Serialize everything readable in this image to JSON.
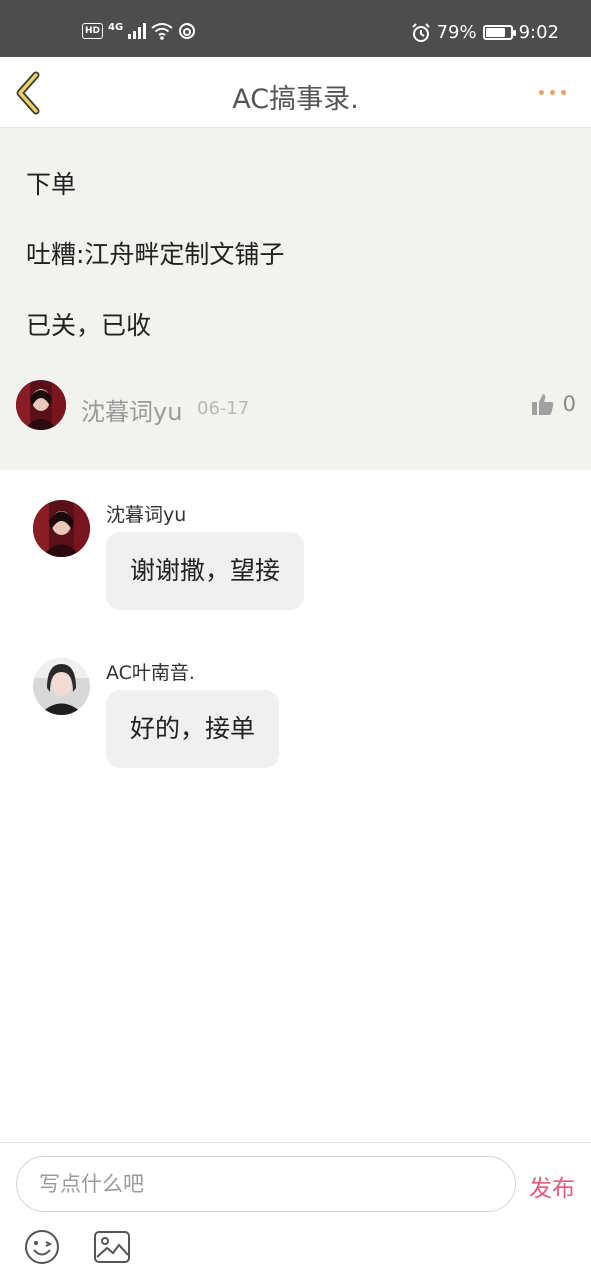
{
  "status_bar": {
    "hd": "HD",
    "network": "4G",
    "battery_percent": "79%",
    "battery_level": 0.79,
    "time": "9:02"
  },
  "header": {
    "title": "AC搞事录.",
    "back_icon": "chevron-left-icon",
    "more_icon": "more-dots-icon",
    "accent_color": "#f0a060"
  },
  "post": {
    "lines": [
      "下单",
      "吐糟:江舟畔定制文铺子",
      "已关，已收"
    ],
    "author": "沈暮词yu",
    "date": "06-17",
    "like_count": "0"
  },
  "comments": [
    {
      "author": "沈暮词yu",
      "text": "谢谢撒，望接"
    },
    {
      "author": "AC叶南音.",
      "text": "好的，接单"
    }
  ],
  "composer": {
    "placeholder": "写点什么吧",
    "publish_label": "发布",
    "publish_color": "#e85a7a",
    "emoji_icon": "emoji-icon",
    "image_icon": "image-icon"
  }
}
